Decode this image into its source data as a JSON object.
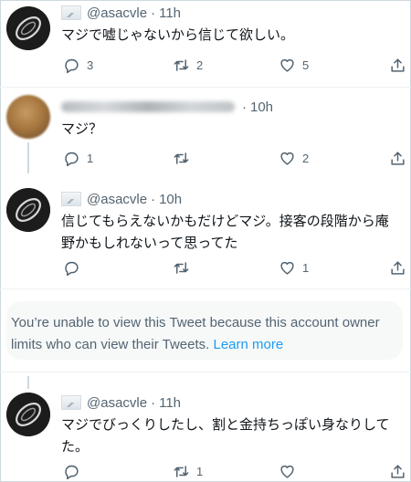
{
  "tweets": [
    {
      "handle": "@asacvle",
      "time": "11h",
      "lines": [
        "マジで嘘じゃないから信じて欲しい。"
      ],
      "replies": "3",
      "retweets": "2",
      "likes": "5"
    },
    {
      "handle": "",
      "time": "10h",
      "lines": [
        "マジ？"
      ],
      "replies": "1",
      "retweets": "",
      "likes": "2"
    },
    {
      "handle": "@asacvle",
      "time": "10h",
      "lines": [
        "信じてもらえないかもだけどマジ。接客の段階から庵",
        "野かもしれないって思ってた"
      ],
      "replies": "",
      "retweets": "",
      "likes": "1"
    },
    {
      "handle": "@asacvle",
      "time": "11h",
      "lines": [
        "マジでびっくりしたし、割と金持ちっぽい身なりして",
        "た。"
      ],
      "replies": "",
      "retweets": "1",
      "likes": ""
    }
  ],
  "notice": {
    "text": "You’re unable to view this Tweet because this account owner limits who can view their Tweets.",
    "link": "Learn more"
  },
  "colors": {
    "link": "#1d9bf0",
    "muted": "#536471",
    "text": "#0f1419",
    "divider": "#eff3f4"
  },
  "icons": [
    "reply-icon",
    "retweet-icon",
    "like-icon",
    "share-icon"
  ]
}
